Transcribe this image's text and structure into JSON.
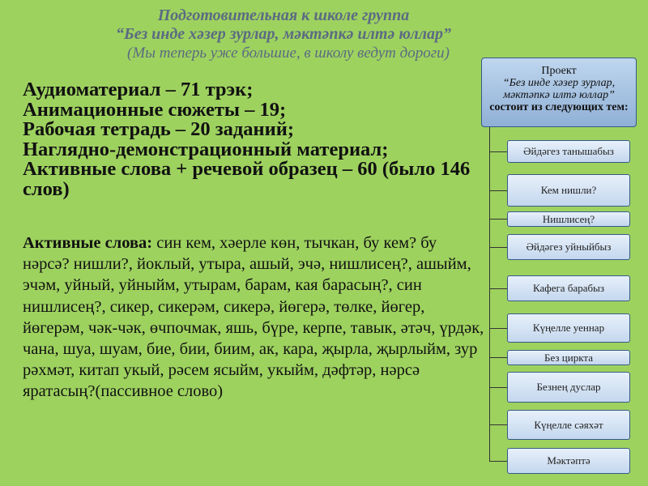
{
  "header": {
    "line1": "Подготовительная к школе группа",
    "line2": "“Без инде хәзер зурлар, мәктәпкә илтә юллар”",
    "line3": "(Мы теперь уже большие, в школу ведут дороги)"
  },
  "facts": [
    "Аудиоматериал – 71 трэк;",
    "Анимационные сюжеты – 19;",
    "Рабочая тетрадь – 20 заданий;",
    "Наглядно-демонстрационный материал;",
    "Активные слова + речевой образец – 60 (было 146 слов)"
  ],
  "active_words": {
    "label": "Активные слова:",
    "text": " син кем, хәерле көн, тычкан, бу кем? бу нәрсә? нишли?, йоклый, утыра, ашый, эчә, нишлисең?, ашыйм, эчәм, уйный, уйныйм, утырам, барам, кая барасың?, син нишлисең?, сикер, сикерәм, сикерә, йөгерә, төлке, йөгер, йөгерәм, чәк-чәк, өчпочмак, яшь, бүре, керпе, тавык, әтәч, үрдәк, чана, шуа, шуам, бие, бии, биим, ак, кара, җырла, җырлыйм, зур рәхмәт, китап укый, рәсем ясыйм, укыйм, дәфтәр, нәрсә яратасың?(пассивное слово)"
  },
  "project": {
    "title": "Проект",
    "name": "“Без инде хәзер зурлар, мәктәпкә илтә юллар”",
    "subtitle": "состоит из следующих тем:"
  },
  "topics": [
    "Әйдәгез танышабыз",
    "Кем нишли?",
    "Нишлисең?",
    "Әйдәгез уйныйбыз",
    "Кафега барабыз",
    "Күңелле уеннар",
    "Без циркта",
    "Безнең дуслар",
    "Күңелле сәяхәт",
    "Мәктәптә"
  ]
}
